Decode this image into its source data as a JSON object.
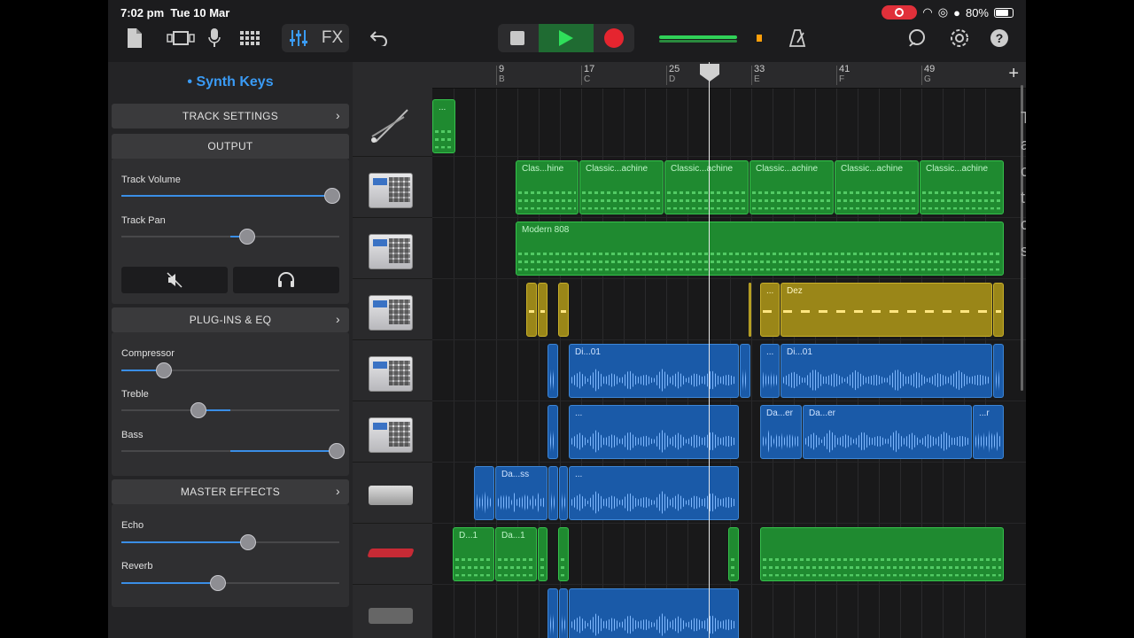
{
  "status_bar": {
    "time": "7:02 pm",
    "date": "Tue 10 Mar",
    "battery": "80%"
  },
  "toolbar": {
    "fx_label": "FX",
    "colors": {
      "play": "#2fe05a",
      "record": "#e5252f",
      "accent": "#3a9bf5"
    }
  },
  "track_title": "Synth Keys",
  "sections": {
    "track_settings": "TRACK SETTINGS",
    "output": "OUTPUT",
    "plugins_eq": "PLUG-INS & EQ",
    "master_effects": "MASTER EFFECTS"
  },
  "sliders": {
    "track_volume": {
      "label": "Track Volume",
      "value": 1.0
    },
    "track_pan": {
      "label": "Track Pan",
      "value": 0.55
    },
    "compressor": {
      "label": "Compressor",
      "value": 0.19
    },
    "treble": {
      "label": "Treble",
      "value": 0.35
    },
    "bass": {
      "label": "Bass",
      "value": 1.0
    },
    "echo": {
      "label": "Echo",
      "value": 0.57
    },
    "reverb": {
      "label": "Reverb",
      "value": 0.43
    }
  },
  "ruler": {
    "bars": [
      {
        "num": "9",
        "letter": "B"
      },
      {
        "num": "17",
        "letter": "C"
      },
      {
        "num": "25",
        "letter": "D"
      },
      {
        "num": "33",
        "letter": "E"
      },
      {
        "num": "41",
        "letter": "F"
      },
      {
        "num": "49",
        "letter": "G"
      }
    ]
  },
  "regions": {
    "r0": "...",
    "r1a": "Clas...hine",
    "r1b": "Classic...achine",
    "r1c": "Classic...achine",
    "r1d": "Classic...achine",
    "r1e": "Classic...achine",
    "r1f": "Classic...achine",
    "r2": "Modern 808",
    "r3a": "...",
    "r3b": "Dez",
    "r4a": "Di...01",
    "r4b": "...",
    "r4c": "Di...01",
    "r5a": "...",
    "r5b": "Da...er",
    "r5c": "Da...er",
    "r5d": "...r",
    "r6a": "...",
    "r6b": "Da...ss",
    "r6c": "...",
    "r7a": "D...1",
    "r7b": "Da...1"
  },
  "side_text": [
    "T",
    "a",
    "c",
    "t",
    "c",
    "s"
  ]
}
